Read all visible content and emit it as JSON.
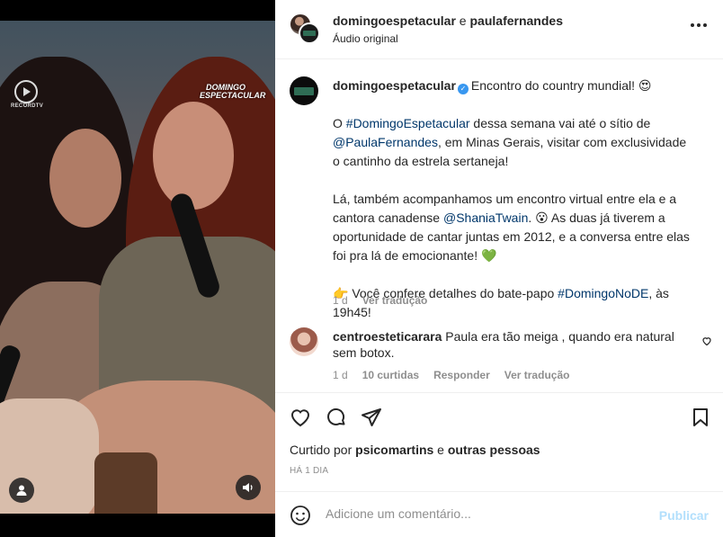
{
  "video": {
    "channel_logo_text": "RECORDTV",
    "show_logo_text": "DOMINGO ESPECTACULAR"
  },
  "header": {
    "user1": "domingoespetacular",
    "conj": " e ",
    "user2": "paulafernandes",
    "subtitle": "Áudio original"
  },
  "caption": {
    "username": "domingoespetacular",
    "line1": "Encontro do country mundial! 😍",
    "p1_a": "O ",
    "p1_tag": "#DomingoEspetacular",
    "p1_b": " dessa semana vai até o sítio de ",
    "p1_mention": "@PaulaFernandes",
    "p1_c": ", em Minas Gerais, visitar com exclusividade o cantinho da estrela sertaneja!",
    "p2_a": "Lá, também acompanhamos um encontro virtual entre ela e a cantora canadense ",
    "p2_mention": "@ShaniaTwain",
    "p2_b": ". 😮 As duas já tiverem a oportunidade de cantar juntas em 2012, e a conversa entre elas foi pra lá de emocionante! 💚",
    "p3_a": "👉 Você confere detalhes do bate-papo ",
    "p3_tag": "#DomingoNoDE",
    "p3_b": ", às 19h45!",
    "time": "1 d",
    "translate": "Ver tradução"
  },
  "comment": {
    "username": "centroesteticarara",
    "text": "Paula era tão meiga , quando era natural sem botox.",
    "time": "1 d",
    "likes": "10 curtidas",
    "reply": "Responder",
    "translate": "Ver tradução"
  },
  "likes": {
    "prefix": "Curtido por ",
    "user": "psicomartins",
    "mid": " e ",
    "others": "outras pessoas"
  },
  "date": "HÁ 1 DIA",
  "add_comment": {
    "placeholder": "Adicione um comentário...",
    "publish": "Publicar"
  },
  "colors": {
    "link": "#00376b",
    "muted": "#8e8e8e",
    "verified": "#3897f0",
    "publish_disabled": "#b2dffc"
  }
}
